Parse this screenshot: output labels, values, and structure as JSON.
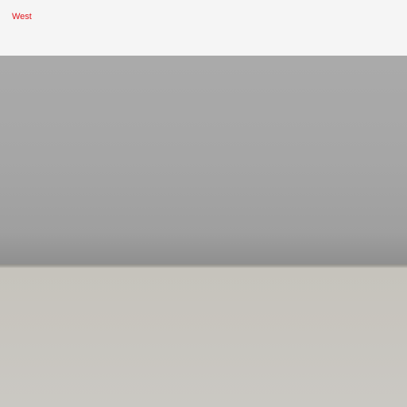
{
  "header": {
    "direction_label": "West"
  },
  "colors": {
    "label": "#e0141c",
    "top_bar": "#f5f5f5",
    "wall": "#a6a6a6",
    "floor": "#c8c5bf"
  }
}
